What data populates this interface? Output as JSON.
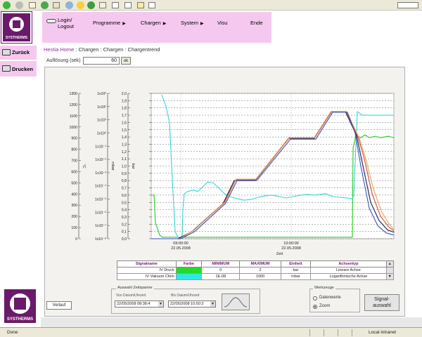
{
  "app": {
    "brand": "SYSTHERMS"
  },
  "nav": {
    "login": "Login/",
    "logout": "Logout",
    "programme": "Programme",
    "chargen": "Chargen",
    "system": "System",
    "visu": "Visu",
    "ende": "Ende"
  },
  "sidebar": {
    "zurueck": "Zurück",
    "drucken": "Drucken"
  },
  "breadcrumb": {
    "home": "Hestia Home",
    "sep": " : ",
    "path": "Chargen : Chargen : Chargentrend"
  },
  "aufloesung": {
    "label": "Auflösung (sek)",
    "value": "60",
    "ok": "ok"
  },
  "chart_data": {
    "type": "line",
    "x_label": "Zeit",
    "x_ticks": [
      {
        "time": "09:00:00",
        "date": "22.05.2008"
      },
      {
        "time": "10:00:00",
        "date": "22.05.2008"
      }
    ],
    "axes": [
      {
        "unit": "°C",
        "ticks": [
          "1300",
          "1200",
          "1100",
          "1000",
          "900",
          "800",
          "700",
          "600",
          "500",
          "400",
          "300",
          "200",
          "100",
          "0"
        ]
      },
      {
        "unit": "mbar",
        "ticks": [
          "1x10³",
          "1x10²",
          "1x10¹",
          "1x10⁰",
          "1x10⁻¹",
          "1x10⁻²",
          "1x10⁻³",
          "1x10⁻⁴",
          "1x10⁻⁵",
          "1x10⁻⁶",
          "1x10⁻⁷",
          "1x10⁻⁸"
        ]
      },
      {
        "unit": "bar",
        "ticks": [
          "2,0",
          "1,9",
          "1,8",
          "1,7",
          "1,6",
          "1,5",
          "1,4",
          "1,3",
          "1,2",
          "1,1",
          "1,0",
          "0,9",
          "0,8",
          "0,7",
          "0,6",
          "0,5",
          "0,4",
          "0,3",
          "0,2",
          "0,1",
          "0,0"
        ]
      }
    ],
    "colors": {
      "green": "#22cc22",
      "cyan": "#33d6d6",
      "dark": "#1c1c40",
      "red": "#d04a3a",
      "orange": "#e8a64a",
      "blue": "#3a52c8"
    },
    "series": [
      {
        "color": "green",
        "points": [
          [
            0,
            0.6
          ],
          [
            4,
            0.6
          ],
          [
            6,
            0.22
          ],
          [
            12,
            0.05
          ],
          [
            16,
            0.02
          ],
          [
            80,
            0.02
          ],
          [
            100,
            0.02
          ],
          [
            286,
            0.02
          ],
          [
            287,
            1.25
          ],
          [
            291,
            1.42
          ],
          [
            298,
            1.39
          ],
          [
            304,
            1.43
          ],
          [
            310,
            1.39
          ],
          [
            318,
            1.41
          ],
          [
            327,
            1.39
          ],
          [
            337,
            1.41
          ],
          [
            345,
            1.39
          ]
        ]
      },
      {
        "color": "cyan",
        "points": [
          [
            15,
            1.98
          ],
          [
            21,
            1.82
          ],
          [
            26,
            1.6
          ],
          [
            30,
            0.82
          ],
          [
            34,
            0.1
          ],
          [
            38,
            0.02
          ],
          [
            42,
            0.01
          ],
          [
            44,
            0.05
          ],
          [
            45,
            0.4
          ],
          [
            47,
            0.62
          ],
          [
            52,
            0.65
          ],
          [
            60,
            0.67
          ],
          [
            66,
            0.65
          ],
          [
            74,
            0.72
          ],
          [
            80,
            0.78
          ],
          [
            88,
            0.77
          ],
          [
            96,
            0.7
          ],
          [
            104,
            0.62
          ],
          [
            112,
            0.58
          ],
          [
            122,
            0.55
          ],
          [
            132,
            0.53
          ],
          [
            142,
            0.54
          ],
          [
            152,
            0.57
          ],
          [
            162,
            0.59
          ],
          [
            172,
            0.6
          ],
          [
            182,
            0.58
          ],
          [
            192,
            0.56
          ],
          [
            202,
            0.58
          ],
          [
            212,
            0.6
          ],
          [
            222,
            0.61
          ],
          [
            232,
            0.6
          ],
          [
            240,
            0.61
          ],
          [
            248,
            0.62
          ],
          [
            258,
            0.58
          ],
          [
            268,
            0.57
          ],
          [
            278,
            0.56
          ],
          [
            286,
            0.55
          ],
          [
            288,
            0.6
          ],
          [
            293,
            1.75
          ],
          [
            300,
            1.7
          ],
          [
            320,
            1.7
          ],
          [
            345,
            1.7
          ]
        ]
      },
      {
        "color": "dark",
        "points": [
          [
            0,
            0
          ],
          [
            38,
            0
          ],
          [
            58,
            0.1
          ],
          [
            102,
            0.48
          ],
          [
            118,
            0.8
          ],
          [
            148,
            0.8
          ],
          [
            196,
            1.38
          ],
          [
            232,
            1.38
          ],
          [
            256,
            1.75
          ],
          [
            276,
            1.75
          ],
          [
            292,
            1.42
          ],
          [
            300,
            1.05
          ],
          [
            312,
            0.5
          ],
          [
            324,
            0.25
          ],
          [
            336,
            0.12
          ],
          [
            345,
            0.09
          ]
        ]
      },
      {
        "color": "red",
        "points": [
          [
            0,
            0
          ],
          [
            40,
            0
          ],
          [
            60,
            0.11
          ],
          [
            104,
            0.5
          ],
          [
            120,
            0.81
          ],
          [
            148,
            0.81
          ],
          [
            196,
            1.39
          ],
          [
            232,
            1.39
          ],
          [
            256,
            1.75
          ],
          [
            277,
            1.75
          ],
          [
            294,
            1.4
          ],
          [
            303,
            1.1
          ],
          [
            314,
            0.62
          ],
          [
            326,
            0.31
          ],
          [
            338,
            0.16
          ],
          [
            345,
            0.11
          ]
        ]
      },
      {
        "color": "orange",
        "points": [
          [
            0,
            0
          ],
          [
            41,
            0
          ],
          [
            61,
            0.12
          ],
          [
            105,
            0.5
          ],
          [
            121,
            0.82
          ],
          [
            149,
            0.82
          ],
          [
            197,
            1.39
          ],
          [
            233,
            1.39
          ],
          [
            257,
            1.75
          ],
          [
            278,
            1.75
          ],
          [
            296,
            1.38
          ],
          [
            305,
            1.1
          ],
          [
            316,
            0.68
          ],
          [
            328,
            0.36
          ],
          [
            340,
            0.18
          ],
          [
            345,
            0.13
          ]
        ]
      },
      {
        "color": "blue",
        "points": [
          [
            0,
            0
          ],
          [
            42,
            0
          ],
          [
            62,
            0.1
          ],
          [
            106,
            0.49
          ],
          [
            122,
            0.8
          ],
          [
            150,
            0.8
          ],
          [
            198,
            1.37
          ],
          [
            234,
            1.37
          ],
          [
            258,
            1.74
          ],
          [
            279,
            1.74
          ],
          [
            290,
            1.45
          ],
          [
            298,
            1.0
          ],
          [
            310,
            0.42
          ],
          [
            322,
            0.18
          ],
          [
            334,
            0.08
          ],
          [
            345,
            0.05
          ]
        ]
      }
    ]
  },
  "signals": {
    "headers": [
      "Signalname",
      "Farbe",
      "MINIMUM",
      "MAXIMUM",
      "Einheit",
      "Achsentyp"
    ],
    "rows": [
      {
        "name": "IV Druck",
        "color": "#22dd22",
        "min": "0",
        "max": "2",
        "unit": "bar",
        "axis": "Lineare Achse"
      },
      {
        "name": "IV Vakuum Cfein",
        "color": "#33e6e6",
        "min": "1E-08",
        "max": "1000",
        "unit": "mbar",
        "axis": "Logarithmische Achse"
      }
    ]
  },
  "verlauf_label": "Verlauf",
  "zeitraum": {
    "legend": "Auswahl Zeitspanne",
    "from_label": "Von Datum/Uhrzeit",
    "from_value": "22/05/2008 08:38:4",
    "to_label": "Bis Datum/Uhrzeit",
    "to_value": "22/05/2008 10:50:3"
  },
  "werkzeuge": {
    "legend": "Werkzeuge",
    "opt1": "Datenwerte",
    "opt2": "Zoom"
  },
  "signal_button": {
    "line1": "Signal-",
    "line2": "auswahl"
  },
  "status": {
    "left": "Done",
    "zone": "Local intranet"
  }
}
